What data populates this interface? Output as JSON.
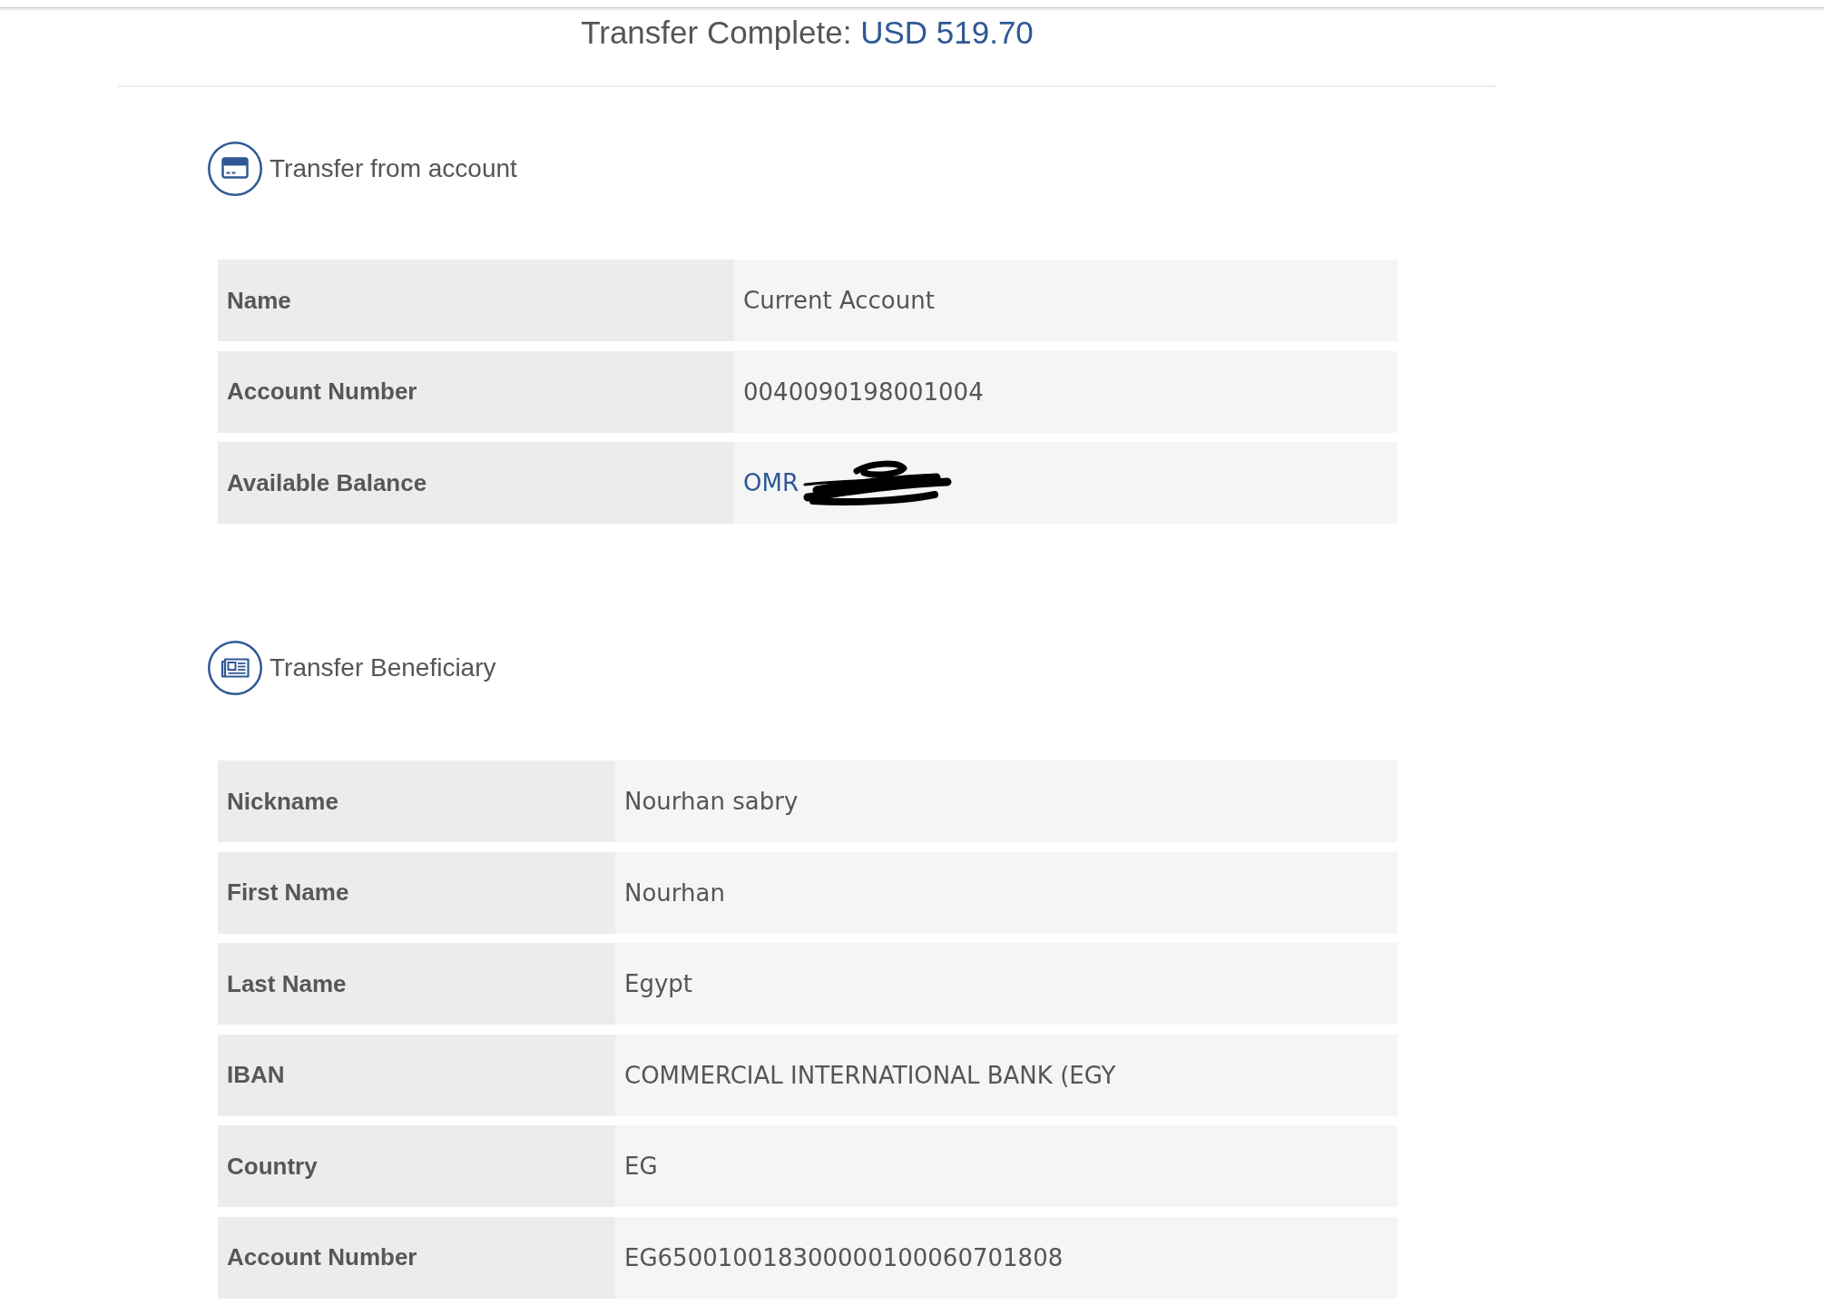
{
  "title": {
    "label": "Transfer Complete:",
    "amount": "USD 519.70"
  },
  "sections": [
    {
      "kind": "account",
      "heading": "Transfer from account",
      "rows": [
        {
          "label": "Name",
          "value": "Current Account",
          "kind": "text",
          "redacted": false
        },
        {
          "label": "Account Number",
          "value": "0040090198001004",
          "kind": "text",
          "redacted": false
        },
        {
          "label": "Available Balance",
          "value": "OMR",
          "kind": "amount",
          "redacted": true
        }
      ]
    },
    {
      "kind": "beneficiary",
      "heading": "Transfer Beneficiary",
      "rows": [
        {
          "label": "Nickname",
          "value": "Nourhan sabry",
          "kind": "text",
          "redacted": false
        },
        {
          "label": "First Name",
          "value": "Nourhan",
          "kind": "text",
          "redacted": false
        },
        {
          "label": "Last Name",
          "value": "Egypt",
          "kind": "text",
          "redacted": false
        },
        {
          "label": "IBAN",
          "value": "COMMERCIAL INTERNATIONAL BANK (EGY",
          "kind": "text",
          "redacted": false
        },
        {
          "label": "Country",
          "value": "EG",
          "kind": "text",
          "redacted": false
        },
        {
          "label": "Account Number",
          "value": "EG650010018300000100060701808",
          "kind": "text",
          "redacted": false
        }
      ]
    }
  ]
}
